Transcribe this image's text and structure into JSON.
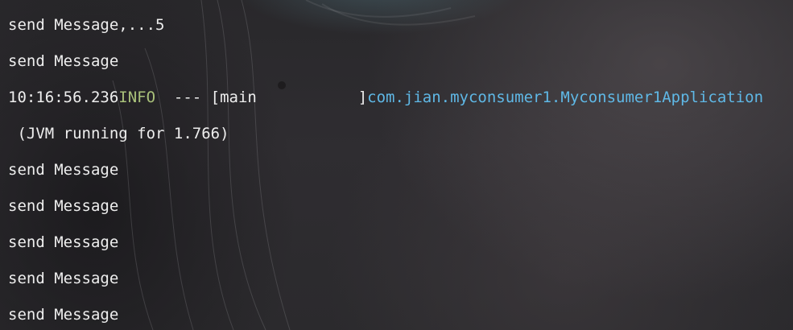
{
  "colors": {
    "default_text": "#eeeeee",
    "info_level": "#a9c17a",
    "logger_name": "#5fb8e6"
  },
  "console": {
    "lines": [
      {
        "text": "send Message,...5"
      },
      {
        "text": "send Message"
      },
      {
        "timestamp": "10:16:56.236",
        "level": "INFO",
        "thread_segment": "  --- [main           ]",
        "logger": "com.jian.myconsumer1.Myconsumer1Application"
      },
      {
        "text": " (JVM running for 1.766)"
      },
      {
        "text": "send Message"
      },
      {
        "text": "send Message"
      },
      {
        "text": "send Message"
      },
      {
        "text": "send Message"
      },
      {
        "text": "send Message"
      }
    ]
  }
}
